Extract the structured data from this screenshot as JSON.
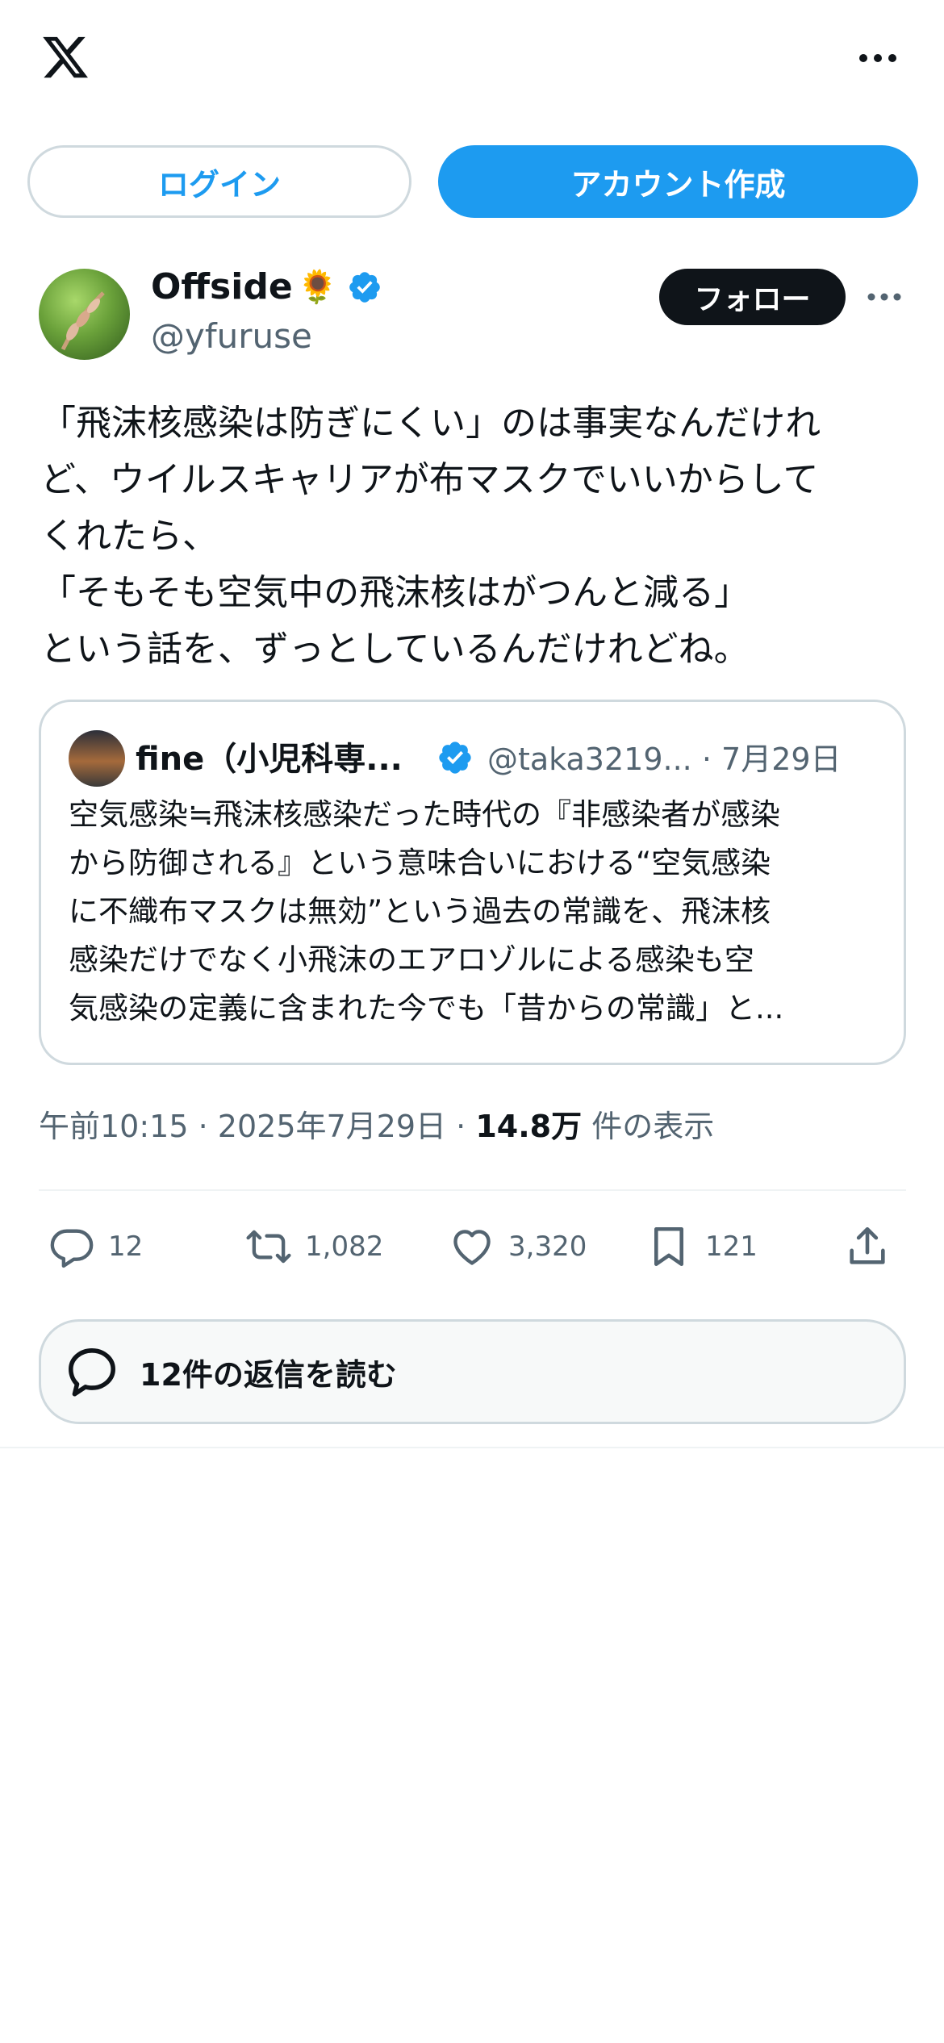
{
  "header": {
    "login_label": "ログイン",
    "signup_label": "アカウント作成"
  },
  "author": {
    "name": "Offside",
    "name_emoji": "🌻",
    "handle": "@yfuruse",
    "verified": true,
    "follow_label": "フォロー"
  },
  "tweet": {
    "lines": [
      "「飛沫核感染は防ぎにくい」のは事実なんだけれ",
      "ど、ウイルスキャリアが布マスクでいいからして",
      "くれたら、",
      "「そもそも空気中の飛沫核はがつんと減る」",
      "という話を、ずっとしているんだけれどね。"
    ]
  },
  "quote": {
    "name": "fine（小児科専...",
    "handle": "@taka3219...",
    "date": "· 7月29日",
    "lines": [
      "空気感染≒飛沫核感染だった時代の『非感染者が感染",
      "から防御される』という意味合いにおける“空気感染",
      "に不織布マスクは無効”という過去の常識を、飛沫核",
      "感染だけでなく小飛沫のエアロゾルによる感染も空",
      "気感染の定義に含まれた今でも「昔からの常識」と..."
    ]
  },
  "meta": {
    "time": "午前10:15",
    "date": "2025年7月29日",
    "separator": "·",
    "views_count": "14.8万",
    "views_label": "件の表示"
  },
  "actions": {
    "replies": "12",
    "retweets": "1,082",
    "likes": "3,320",
    "bookmarks": "121"
  },
  "read_replies_label": "12件の返信を読む",
  "colors": {
    "accent": "#1d9bf0",
    "text": "#0f1419",
    "secondary": "#536471",
    "border": "#cfd9de"
  }
}
